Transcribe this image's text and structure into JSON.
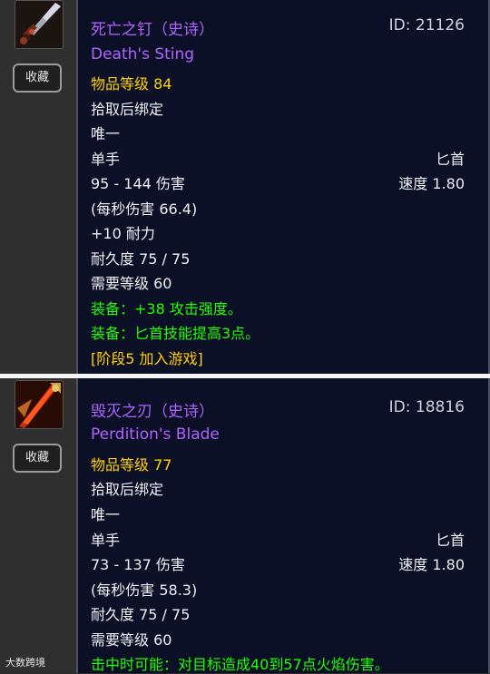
{
  "items": [
    {
      "name": "死亡之钉（史诗）",
      "english_name": "Death's Sting",
      "id_text": "ID: 21126",
      "item_level": "物品等级 84",
      "bind": "拾取后绑定",
      "unique": "唯一",
      "hand": "单手",
      "weapon_type": "匕首",
      "damage": "95 - 144 伤害",
      "speed": "速度 1.80",
      "dps": "(每秒伤害 66.4)",
      "stat": "+10 耐力",
      "durability": "耐久度 75 / 75",
      "required_level": "需要等级 60",
      "equip1": "装备：+38 攻击强度。",
      "equip2": "装备：匕首技能提高3点。",
      "phase": "[阶段5 加入游戏]",
      "collect_label": "收藏",
      "icon": "dagger-icon"
    },
    {
      "name": "毁灭之刃（史诗）",
      "english_name": "Perdition's Blade",
      "id_text": "ID: 18816",
      "item_level": "物品等级 77",
      "bind": "拾取后绑定",
      "unique": "唯一",
      "hand": "单手",
      "weapon_type": "匕首",
      "damage": "73 - 137 伤害",
      "speed": "速度 1.80",
      "dps": "(每秒伤害 58.3)",
      "durability": "耐久度 75 / 75",
      "required_level": "需要等级 60",
      "chance_on_hit": "击中时可能：对目标造成40到57点火焰伤害。",
      "collect_label": "收藏",
      "icon": "flame-blade-icon"
    }
  ],
  "watermark": "大数跨境",
  "colors": {
    "epic": "#b063ff",
    "item_level": "#ffd100",
    "green_text": "#1fff00",
    "tooltip_bg": "#0c1027"
  }
}
